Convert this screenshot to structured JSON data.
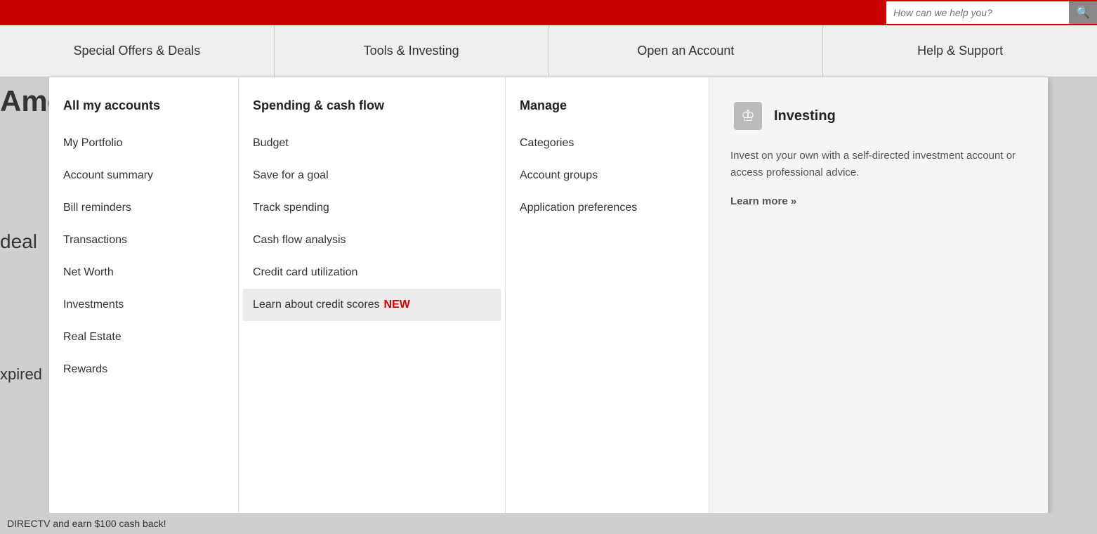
{
  "topbar": {
    "search_placeholder": "How can we help you?"
  },
  "nav": {
    "items": [
      {
        "id": "special-offers",
        "label": "Special Offers & Deals"
      },
      {
        "id": "tools-investing",
        "label": "Tools & Investing"
      },
      {
        "id": "open-account",
        "label": "Open an Account"
      },
      {
        "id": "help-support",
        "label": "Help & Support"
      }
    ]
  },
  "mega_menu": {
    "col_accounts": {
      "header": "All my accounts",
      "links": [
        "My Portfolio",
        "Account summary",
        "Bill reminders",
        "Transactions",
        "Net Worth",
        "Investments",
        "Real Estate",
        "Rewards"
      ]
    },
    "col_spending": {
      "header": "Spending & cash flow",
      "links": [
        "Budget",
        "Save for a goal",
        "Track spending",
        "Cash flow analysis",
        "Credit card utilization"
      ],
      "highlighted_link": "Learn about credit scores",
      "highlighted_badge": "NEW"
    },
    "col_manage": {
      "header": "Manage",
      "links": [
        "Categories",
        "Account groups",
        "Application preferences"
      ]
    },
    "col_investing": {
      "icon_label": "investing-icon",
      "title": "Investing",
      "description": "Invest on your own with a self-directed investment account or access professional advice.",
      "learn_more": "Learn more »"
    }
  },
  "partial_text": {
    "ame": "Ame",
    "deal": "deal",
    "expired": "xpired",
    "ticker": "DIRECTV and earn $100 cash back!"
  }
}
